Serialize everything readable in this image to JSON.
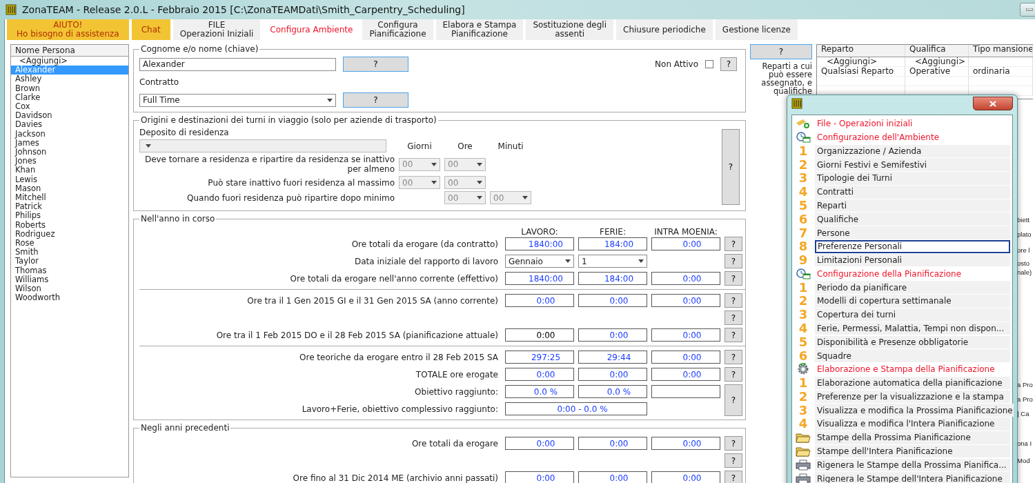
{
  "window": {
    "title": "ZonaTEAM - Release 2.0.L - Febbraio 2015 [C:\\ZonaTEAMDati\\Smith_Carpentry_Scheduling]"
  },
  "tabs": [
    {
      "label": "AIUTO!\nHo bisogno di assistenza",
      "kind": "help",
      "selected": false
    },
    {
      "label": "Chat",
      "kind": "help",
      "selected": false
    },
    {
      "label": "FILE\nOperazioni Iniziali",
      "kind": "normal",
      "selected": false
    },
    {
      "label": "Configura Ambiente",
      "kind": "normal",
      "selected": true
    },
    {
      "label": "Configura\nPianificazione",
      "kind": "normal",
      "selected": false
    },
    {
      "label": "Elabora e Stampa\nPianificazione",
      "kind": "normal",
      "selected": false
    },
    {
      "label": "Sostituzione degli\nassenti",
      "kind": "normal",
      "selected": false
    },
    {
      "label": "Chiusure periodiche",
      "kind": "normal",
      "selected": false
    },
    {
      "label": "Gestione licenze",
      "kind": "normal",
      "selected": false
    }
  ],
  "persons": {
    "header": "Nome Persona",
    "items": [
      {
        "name": "<Aggiungi>",
        "selected": false
      },
      {
        "name": "Alexander",
        "selected": true
      },
      {
        "name": "Ashley",
        "selected": false
      },
      {
        "name": "Brown",
        "selected": false
      },
      {
        "name": "Clarke",
        "selected": false
      },
      {
        "name": "Cox",
        "selected": false
      },
      {
        "name": "Davidson",
        "selected": false
      },
      {
        "name": "Davies",
        "selected": false
      },
      {
        "name": "Jackson",
        "selected": false
      },
      {
        "name": "James",
        "selected": false
      },
      {
        "name": "Johnson",
        "selected": false
      },
      {
        "name": "Jones",
        "selected": false
      },
      {
        "name": "Khan",
        "selected": false
      },
      {
        "name": "Lewis",
        "selected": false
      },
      {
        "name": "Mason",
        "selected": false
      },
      {
        "name": "Mitchell",
        "selected": false
      },
      {
        "name": "Patrick",
        "selected": false
      },
      {
        "name": "Philips",
        "selected": false
      },
      {
        "name": "Roberts",
        "selected": false
      },
      {
        "name": "Rodriguez",
        "selected": false
      },
      {
        "name": "Rose",
        "selected": false
      },
      {
        "name": "Smith",
        "selected": false
      },
      {
        "name": "Taylor",
        "selected": false
      },
      {
        "name": "Thomas",
        "selected": false
      },
      {
        "name": "Williams",
        "selected": false
      },
      {
        "name": "Wilson",
        "selected": false
      },
      {
        "name": "Woodworth",
        "selected": false
      }
    ]
  },
  "identity": {
    "legend": "Cognome e/o nome (chiave)",
    "name_value": "Alexander",
    "name_help": "?",
    "inactive_label": "Non Attivo",
    "inactive_checked": false,
    "inactive_help": "?",
    "contract_label": "Contratto",
    "contract_value": "Full Time",
    "contract_help": "?"
  },
  "travel": {
    "legend": "Origini e destinazioni dei turni in viaggio (solo per aziende di trasporto)",
    "depot_label": "Deposito di residenza",
    "disabled": true,
    "columns": [
      "Giorni",
      "Ore",
      "Minuti"
    ],
    "help": "?",
    "rows": [
      {
        "label": "Deve tornare a residenza e ripartire da residenza se inattivo per almeno",
        "giorni": "00",
        "ore": "00"
      },
      {
        "label": "Può stare inattivo fuori residenza al massimo",
        "giorni": "00",
        "ore": "00"
      },
      {
        "label": "Quando fuori residenza può ripartire dopo minimo",
        "ore": "00",
        "minuti": "00"
      }
    ]
  },
  "current_year": {
    "legend": "Nell'anno in corso",
    "columns": [
      "LAVORO:",
      "FERIE:",
      "INTRA MOENIA:"
    ],
    "groups": [
      [
        {
          "label": "Ore totali da erogare (da contratto)",
          "help": "?",
          "cells": [
            {
              "kind": "field",
              "text": "1840:00",
              "color": "#1a3cff"
            },
            {
              "kind": "field",
              "text": "184:00",
              "color": "#1a3cff"
            },
            {
              "kind": "field",
              "text": "0:00",
              "color": "#1a3cff"
            }
          ]
        },
        {
          "label": "Data iniziale del rapporto di lavoro",
          "help": "?",
          "cells": [
            {
              "kind": "select",
              "text": "Gennaio"
            },
            {
              "kind": "select",
              "text": "1"
            }
          ]
        },
        {
          "label": "Ore totali da erogare nell'anno corrente (effettivo)",
          "help": "?",
          "cells": [
            {
              "kind": "field",
              "text": "1840:00",
              "color": "#1a3cff"
            },
            {
              "kind": "field",
              "text": "184:00",
              "color": "#1a3cff"
            },
            {
              "kind": "field",
              "text": "0:00",
              "color": "#1a3cff"
            }
          ]
        }
      ],
      [
        {
          "label": "Ore tra il 1 Gen 2015 GI e il 31 Gen 2015 SA (anno corrente)",
          "help": "?",
          "cells": [
            {
              "kind": "field",
              "text": "0:00",
              "color": "#1a3cff"
            },
            {
              "kind": "field",
              "text": "0:00",
              "color": "#1a3cff"
            },
            {
              "kind": "field",
              "text": "0:00",
              "color": "#1a3cff"
            }
          ]
        },
        {
          "help": "?"
        },
        {
          "label": "Ore tra il 1 Feb 2015 DO e il 28 Feb 2015 SA (pianificazione attuale)",
          "help": "?",
          "cells": [
            {
              "kind": "field",
              "text": "0:00",
              "color": "#000000"
            },
            {
              "kind": "field",
              "text": "0:00",
              "color": "#1a3cff"
            },
            {
              "kind": "field",
              "text": "0:00",
              "color": "#1a3cff"
            }
          ]
        }
      ],
      [
        {
          "label": "Ore teoriche da erogare entro il 28 Feb 2015 SA",
          "help": "?",
          "cells": [
            {
              "kind": "field",
              "text": "297:25",
              "color": "#1a3cff"
            },
            {
              "kind": "field",
              "text": "29:44",
              "color": "#1a3cff"
            },
            {
              "kind": "field",
              "text": "0:00",
              "color": "#1a3cff"
            }
          ]
        },
        {
          "label": "TOTALE ore erogate",
          "help": "?",
          "cells": [
            {
              "kind": "field",
              "text": "0:00",
              "color": "#1a3cff"
            },
            {
              "kind": "field",
              "text": "0:00",
              "color": "#1a3cff"
            },
            {
              "kind": "field",
              "text": "0:00",
              "color": "#1a3cff"
            }
          ]
        },
        {
          "label": "Obiettivo raggiunto:",
          "help": "?",
          "cells": [
            {
              "kind": "field",
              "text": "0.0 %",
              "color": "#1a3cff"
            },
            {
              "kind": "field",
              "text": "0.0 %",
              "color": "#1a3cff"
            },
            {
              "kind": "blank"
            }
          ]
        },
        {
          "label": "Lavoro+Ferie, obiettivo complessivo raggiunto:",
          "cells": [
            {
              "kind": "wide",
              "text": "0:00 - 0.0 %",
              "color": "#1a3cff"
            }
          ]
        }
      ]
    ]
  },
  "previous_years": {
    "legend": "Negli anni precedenti",
    "rows": [
      {
        "label": "Ore totali da erogare",
        "help": "?",
        "cells": [
          {
            "kind": "field",
            "text": "0:00",
            "color": "#1a3cff"
          },
          {
            "kind": "field",
            "text": "0:00",
            "color": "#1a3cff"
          },
          {
            "kind": "field",
            "text": "0:00",
            "color": "#1a3cff"
          }
        ]
      },
      {
        "help": "?"
      },
      {
        "label": "Ore fino al 31 Dic 2014 ME (archivio anni passati)",
        "help": "?",
        "cells": [
          {
            "kind": "field",
            "text": "0:00",
            "color": "#1a3cff"
          },
          {
            "kind": "field",
            "text": "0:00",
            "color": "#1a3cff"
          },
          {
            "kind": "field",
            "text": "0:00",
            "color": "#1a3cff"
          }
        ]
      }
    ]
  },
  "departments": {
    "help": "?",
    "caption": "Reparti a cui può essere assegnato, e qualifiche",
    "columns": [
      "Reparto",
      "Qualifica",
      "Tipo mansione"
    ],
    "rows": [
      [
        "<Aggiungi>",
        "<Aggiungi>",
        ""
      ],
      [
        "Qualsiasi Reparto",
        "Operative",
        "ordinaria"
      ]
    ]
  },
  "background_window": {
    "fragments": [
      "biett",
      "plato",
      "ore l",
      "osto",
      "nale)",
      "a Pro",
      "a Pro",
      "] Ca",
      "ona I",
      "Mod"
    ]
  },
  "menu": {
    "items": [
      {
        "kind": "file",
        "label": "File - Operazioni iniziali",
        "highlight": true,
        "selected": false
      },
      {
        "kind": "clock",
        "label": "Configurazione dell'Ambiente",
        "highlight": true,
        "selected": false
      },
      {
        "kind": "number",
        "number": "1",
        "label": "Organizzazione / Azienda",
        "highlight": false,
        "selected": false
      },
      {
        "kind": "number",
        "number": "2",
        "label": "Giorni Festivi e Semifestivi",
        "highlight": false,
        "selected": false
      },
      {
        "kind": "number",
        "number": "3",
        "label": "Tipologie dei Turni",
        "highlight": false,
        "selected": false
      },
      {
        "kind": "number",
        "number": "4",
        "label": "Contratti",
        "highlight": false,
        "selected": false
      },
      {
        "kind": "number",
        "number": "5",
        "label": "Reparti",
        "highlight": false,
        "selected": false
      },
      {
        "kind": "number",
        "number": "6",
        "label": "Qualifiche",
        "highlight": false,
        "selected": false
      },
      {
        "kind": "number",
        "number": "7",
        "label": "Persone",
        "highlight": false,
        "selected": false
      },
      {
        "kind": "number",
        "number": "8",
        "label": "Preferenze Personali",
        "highlight": false,
        "selected": true
      },
      {
        "kind": "number",
        "number": "9",
        "label": "Limitazioni Personali",
        "highlight": false,
        "selected": false
      },
      {
        "kind": "clock",
        "label": "Configurazione della Pianificazione",
        "highlight": true,
        "selected": false
      },
      {
        "kind": "number",
        "number": "1",
        "label": "Periodo da pianificare",
        "highlight": false,
        "selected": false
      },
      {
        "kind": "number",
        "number": "2",
        "label": "Modelli di copertura settimanale",
        "highlight": false,
        "selected": false
      },
      {
        "kind": "number",
        "number": "3",
        "label": "Copertura dei turni",
        "highlight": false,
        "selected": false
      },
      {
        "kind": "number",
        "number": "4",
        "label": "Ferie, Permessi, Malattia, Tempi non dispon...",
        "highlight": false,
        "selected": false
      },
      {
        "kind": "number",
        "number": "5",
        "label": "Disponibilità e Presenze obbligatorie",
        "highlight": false,
        "selected": false
      },
      {
        "kind": "number",
        "number": "6",
        "label": "Squadre",
        "highlight": false,
        "selected": false
      },
      {
        "kind": "gear",
        "label": "Elaborazione e Stampa della Pianificazione",
        "highlight": true,
        "selected": false
      },
      {
        "kind": "number",
        "number": "1",
        "label": "Elaborazione automatica della pianificazione",
        "highlight": false,
        "selected": false
      },
      {
        "kind": "number",
        "number": "2",
        "label": "Preferenze per la visualizzazione e la stampa",
        "highlight": false,
        "selected": false
      },
      {
        "kind": "number",
        "number": "3",
        "label": "Visualizza e modifica la Prossima Pianificazione",
        "highlight": false,
        "selected": false
      },
      {
        "kind": "number",
        "number": "4",
        "label": "Visualizza e modifica l'Intera Pianificazione",
        "highlight": false,
        "selected": false
      },
      {
        "kind": "folder",
        "label": "Stampe della Prossima Pianificazione",
        "highlight": false,
        "selected": false
      },
      {
        "kind": "folder",
        "label": "Stampe dell'Intera Pianificazione",
        "highlight": false,
        "selected": false
      },
      {
        "kind": "printer",
        "label": "Rigenera le Stampe della Prossima Pianifica...",
        "highlight": false,
        "selected": false
      },
      {
        "kind": "printer",
        "label": "Rigenera le Stampe dell'Intera Pianificazione",
        "highlight": false,
        "selected": false
      }
    ]
  }
}
